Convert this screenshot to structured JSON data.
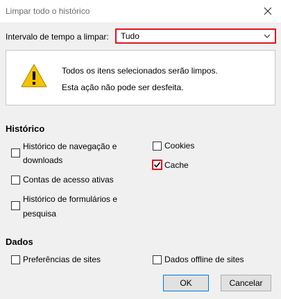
{
  "window": {
    "title": "Limpar todo o histórico"
  },
  "range": {
    "label": "Intervalo de tempo a limpar:",
    "value": "Tudo"
  },
  "info": {
    "line1": "Todos os itens selecionados serão limpos.",
    "line2": "Esta ação não pode ser desfeita."
  },
  "history": {
    "heading": "Histórico",
    "items": [
      {
        "label_line1": "Histórico de navegação e",
        "label_line2": "downloads",
        "checked": false
      },
      {
        "label": "Contas de acesso ativas",
        "checked": false
      },
      {
        "label_line1": "Histórico de formulários e",
        "label_line2": "pesquisa",
        "checked": false
      },
      {
        "label": "Cookies",
        "checked": false
      },
      {
        "label": "Cache",
        "checked": true
      }
    ]
  },
  "data_section": {
    "heading": "Dados",
    "items": [
      {
        "label": "Preferências de sites",
        "checked": false
      },
      {
        "label": "Dados offline de sites",
        "checked": false
      }
    ]
  },
  "buttons": {
    "ok": "OK",
    "cancel": "Cancelar"
  },
  "colors": {
    "highlight": "#e0141e",
    "warning": "#f5c400"
  }
}
